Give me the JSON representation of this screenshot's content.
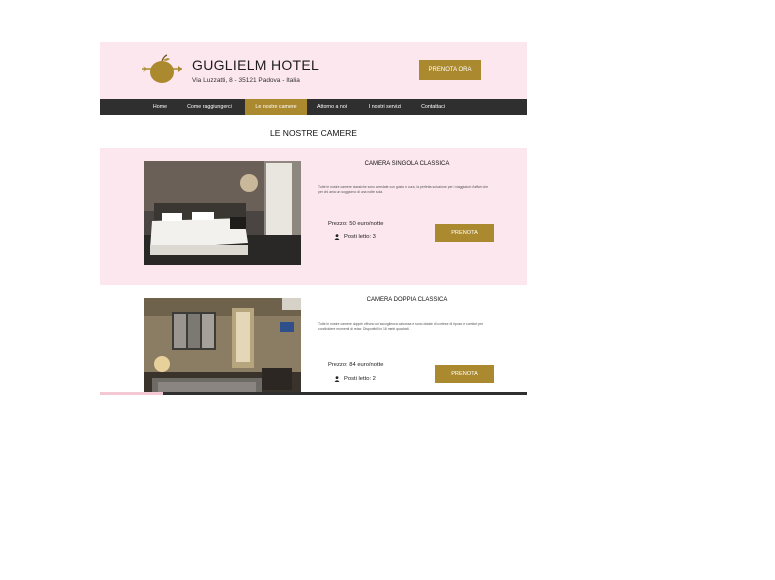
{
  "header": {
    "title": "GUGLIELM HOTEL",
    "address": "Via Luzzatti, 8 - 35121 Padova - Italia",
    "book_now": "PRENOTA ORA",
    "logo_icon": "apple-arrow-logo"
  },
  "nav": {
    "items": [
      {
        "label": "Home"
      },
      {
        "label": "Come raggiungerci"
      },
      {
        "label": "Le nostre camere"
      },
      {
        "label": "Attorno a noi"
      },
      {
        "label": "I nostri servizi"
      },
      {
        "label": "Contattaci"
      }
    ],
    "active": "Le nostre camere"
  },
  "section_title": "LE NOSTRE CAMERE",
  "rooms": [
    {
      "name": "CAMERA SINGOLA CLASSICA",
      "description": "Tutte le nostre camere classiche sono arredate con gusto e cura, la perfetta soluzione per i viaggiatori d'affari che per chi ama un soggiorno di una notte sola.",
      "price": "Prezzo: 50 euro/notte",
      "beds": "Posti letto: 3",
      "book_label": "PRENOTA"
    },
    {
      "name": "CAMERA DOPPIA CLASSICA",
      "description": "Tutte le nostre camere doppie offrono un'accoglienza calorosa e sono dotate di cortese di riposo e comfort per condividere momenti di relax. Disponibili in 16 metri quadrati.",
      "price": "Prezzo: 84 euro/notte",
      "beds": "Posti letto: 2",
      "book_label": "PRENOTA"
    }
  ],
  "colors": {
    "accent": "#ab8a2f",
    "header_bg": "#fde7ef",
    "nav_bg": "#2f2f30"
  }
}
